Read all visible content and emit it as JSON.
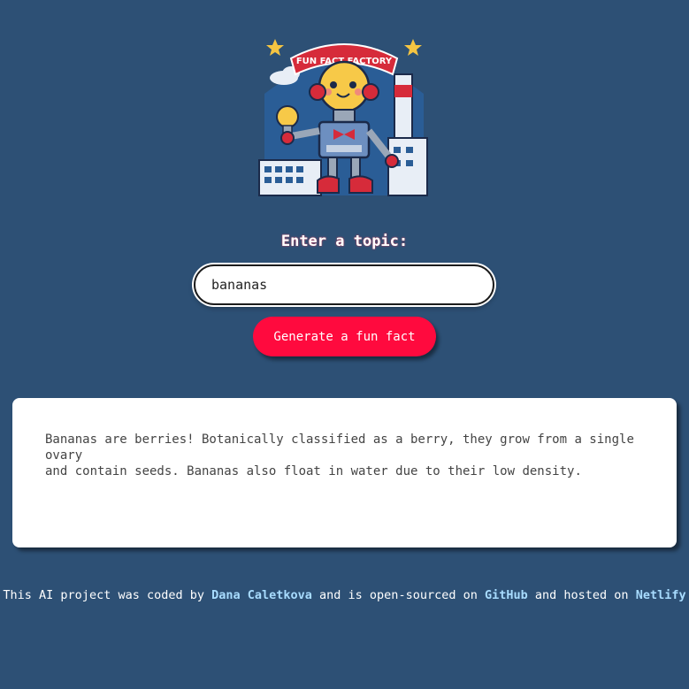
{
  "logo": {
    "banner_text": "FUN FACT FACTORY",
    "icon": "robot-lightbulb-factory-logo"
  },
  "form": {
    "label": "Enter a topic:",
    "topic_value": "bananas",
    "button_label": "Generate a fun fact"
  },
  "fact": {
    "line1": "Bananas are berries! Botanically classified as a berry, they grow from a single ovary",
    "line2": "and contain seeds. Bananas also float in water due to their low density."
  },
  "footer": {
    "text1": "This AI project was coded by ",
    "author": "Dana Caletkova",
    "text2": " and is open-sourced on ",
    "github": "GitHub",
    "text3": " and hosted on ",
    "netlify": "Netlify"
  },
  "colors": {
    "background": "#2d5075",
    "button": "#ff0a3e",
    "link": "#a8dcff"
  }
}
